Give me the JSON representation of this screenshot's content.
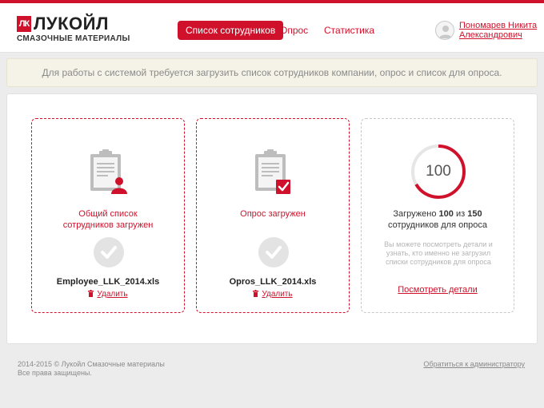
{
  "brand": {
    "logo_mark": "ЛК",
    "name": "ЛУКОЙЛ",
    "subtitle": "СМАЗОЧНЫЕ МАТЕРИАЛЫ"
  },
  "nav": {
    "items": [
      {
        "label": "Список сотрудников",
        "active": true
      },
      {
        "label": "Опрос",
        "active": false
      },
      {
        "label": "Статистика",
        "active": false
      }
    ]
  },
  "user": {
    "first_line": "Пономарев Никита",
    "second_line": "Александрович"
  },
  "notice": "Для работы с системой требуется загрузить список сотрудников компании, опрос и список для опроса.",
  "cards": {
    "employees": {
      "title_line1": "Общий список",
      "title_line2": "сотрудников загружен",
      "filename": "Employee_LLK_2014.xls",
      "delete_label": "Удалить"
    },
    "survey": {
      "title": "Опрос загружен",
      "filename": "Opros_LLK_2014.xls",
      "delete_label": "Удалить"
    },
    "stats": {
      "progress_value": "100",
      "loaded": 100,
      "total": 150,
      "text_prefix": "Загружено",
      "text_mid": "из",
      "text_line2": "сотрудников для опроса",
      "description": "Вы можете посмотреть детали и узнать, кто именно не загрузил списки сотрудников для опроса",
      "details_link": "Посмотреть детали"
    }
  },
  "footer": {
    "copyright_line1": "2014-2015 © Лукойл Смазочные материалы",
    "copyright_line2": "Все права защищены.",
    "admin_link": "Обратиться к администратору"
  },
  "colors": {
    "accent": "#d0112b",
    "muted": "#8a8a8a",
    "check_bg": "#e3e3e3"
  }
}
